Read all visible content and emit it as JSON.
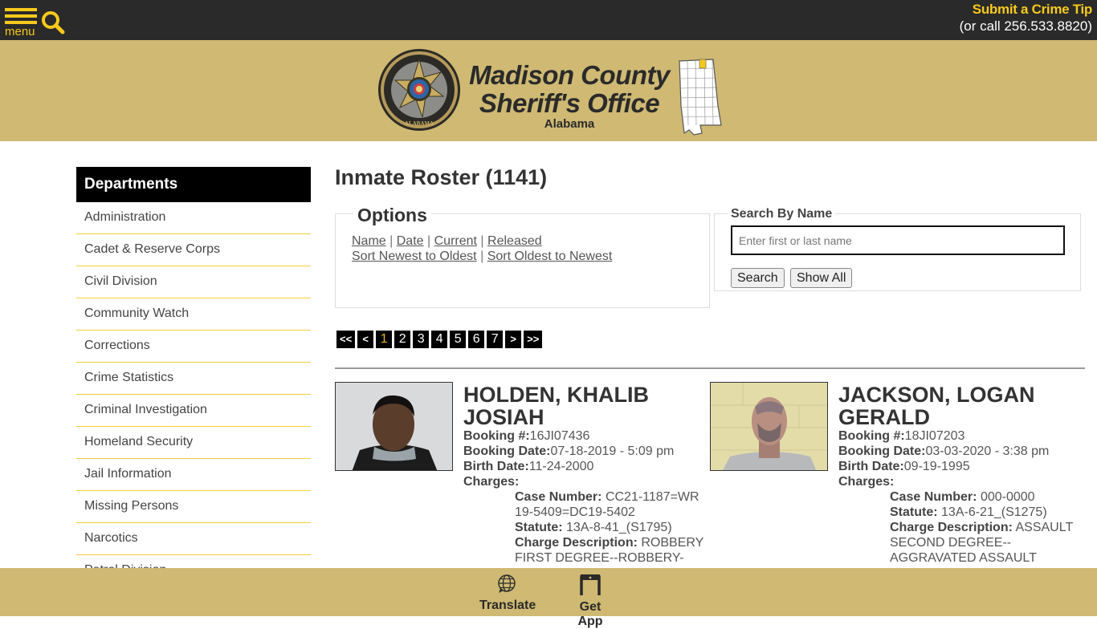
{
  "topbar": {
    "menu_label": "menu",
    "menu_icon": "hamburger-icon",
    "search_icon": "search-icon",
    "tip_title": "Submit a Crime Tip",
    "tip_call": "(or call 256.533.8820)",
    "accent_color": "#f7c91c"
  },
  "banner": {
    "title_line1": "Madison County",
    "title_line2": "Sheriff's Office",
    "subtitle": "Alabama",
    "seal_icon": "sheriff-badge-seal-icon",
    "map_icon": "alabama-county-map-icon",
    "background_color": "#cfb973"
  },
  "sidebar": {
    "heading": "Departments",
    "items": [
      {
        "label": "Administration"
      },
      {
        "label": "Cadet & Reserve Corps"
      },
      {
        "label": "Civil Division"
      },
      {
        "label": "Community Watch"
      },
      {
        "label": "Corrections"
      },
      {
        "label": "Crime Statistics"
      },
      {
        "label": "Criminal Investigation"
      },
      {
        "label": "Homeland Security"
      },
      {
        "label": "Jail Information"
      },
      {
        "label": "Missing Persons"
      },
      {
        "label": "Narcotics"
      },
      {
        "label": "Patrol Division"
      }
    ]
  },
  "main": {
    "title": "Inmate Roster (1141)",
    "options": {
      "legend": "Options",
      "filter_links": [
        "Name",
        "Date",
        "Current",
        "Released"
      ],
      "sort_links": [
        "Sort Newest to Oldest",
        "Sort Oldest to Newest"
      ],
      "separator": "|"
    },
    "search": {
      "legend": "Search By Name",
      "placeholder": "Enter first or last name",
      "value": "",
      "search_button": "Search",
      "show_all_button": "Show All"
    },
    "pagination": {
      "first": "<<",
      "prev": "<",
      "pages": [
        "1",
        "2",
        "3",
        "4",
        "5",
        "6",
        "7"
      ],
      "current_page": "1",
      "next": ">",
      "last": ">>"
    },
    "inmates": [
      {
        "name": "HOLDEN, KHALIB JOSIAH",
        "booking_number_label": "Booking #:",
        "booking_number": "16JI07436",
        "booking_date_label": "Booking Date:",
        "booking_date": "07-18-2019 - 5:09 pm",
        "birth_date_label": "Birth Date:",
        "birth_date": "11-24-2000",
        "charges_label": "Charges:",
        "case_number_label": "Case Number:",
        "case_number": "CC21-1187=WR19-5409=DC19-5402",
        "statute_label": "Statute:",
        "statute": "13A-8-41_(S1795)",
        "charge_description_label": "Charge Description:",
        "charge_description": "ROBBERY FIRST DEGREE--ROBBERY-RESIDENCE-GUN"
      },
      {
        "name": "JACKSON, LOGAN GERALD",
        "booking_number_label": "Booking #:",
        "booking_number": "18JI07203",
        "booking_date_label": "Booking Date:",
        "booking_date": "03-03-2020 - 3:38 pm",
        "birth_date_label": "Birth Date:",
        "birth_date": "09-19-1995",
        "charges_label": "Charges:",
        "case_number_label": "Case Number:",
        "case_number": "000-0000",
        "statute_label": "Statute:",
        "statute": "13A-6-21_(S1275)",
        "charge_description_label": "Charge Description:",
        "charge_description": "ASSAULT SECOND DEGREE--AGGRAVATED ASSAULT POLICE OFFICER-OTHER WEAPON"
      }
    ]
  },
  "bottombar": {
    "translate_label": "Translate",
    "translate_icon": "globe-icon",
    "app_label": "Get App",
    "app_icon": "phone-icon"
  }
}
